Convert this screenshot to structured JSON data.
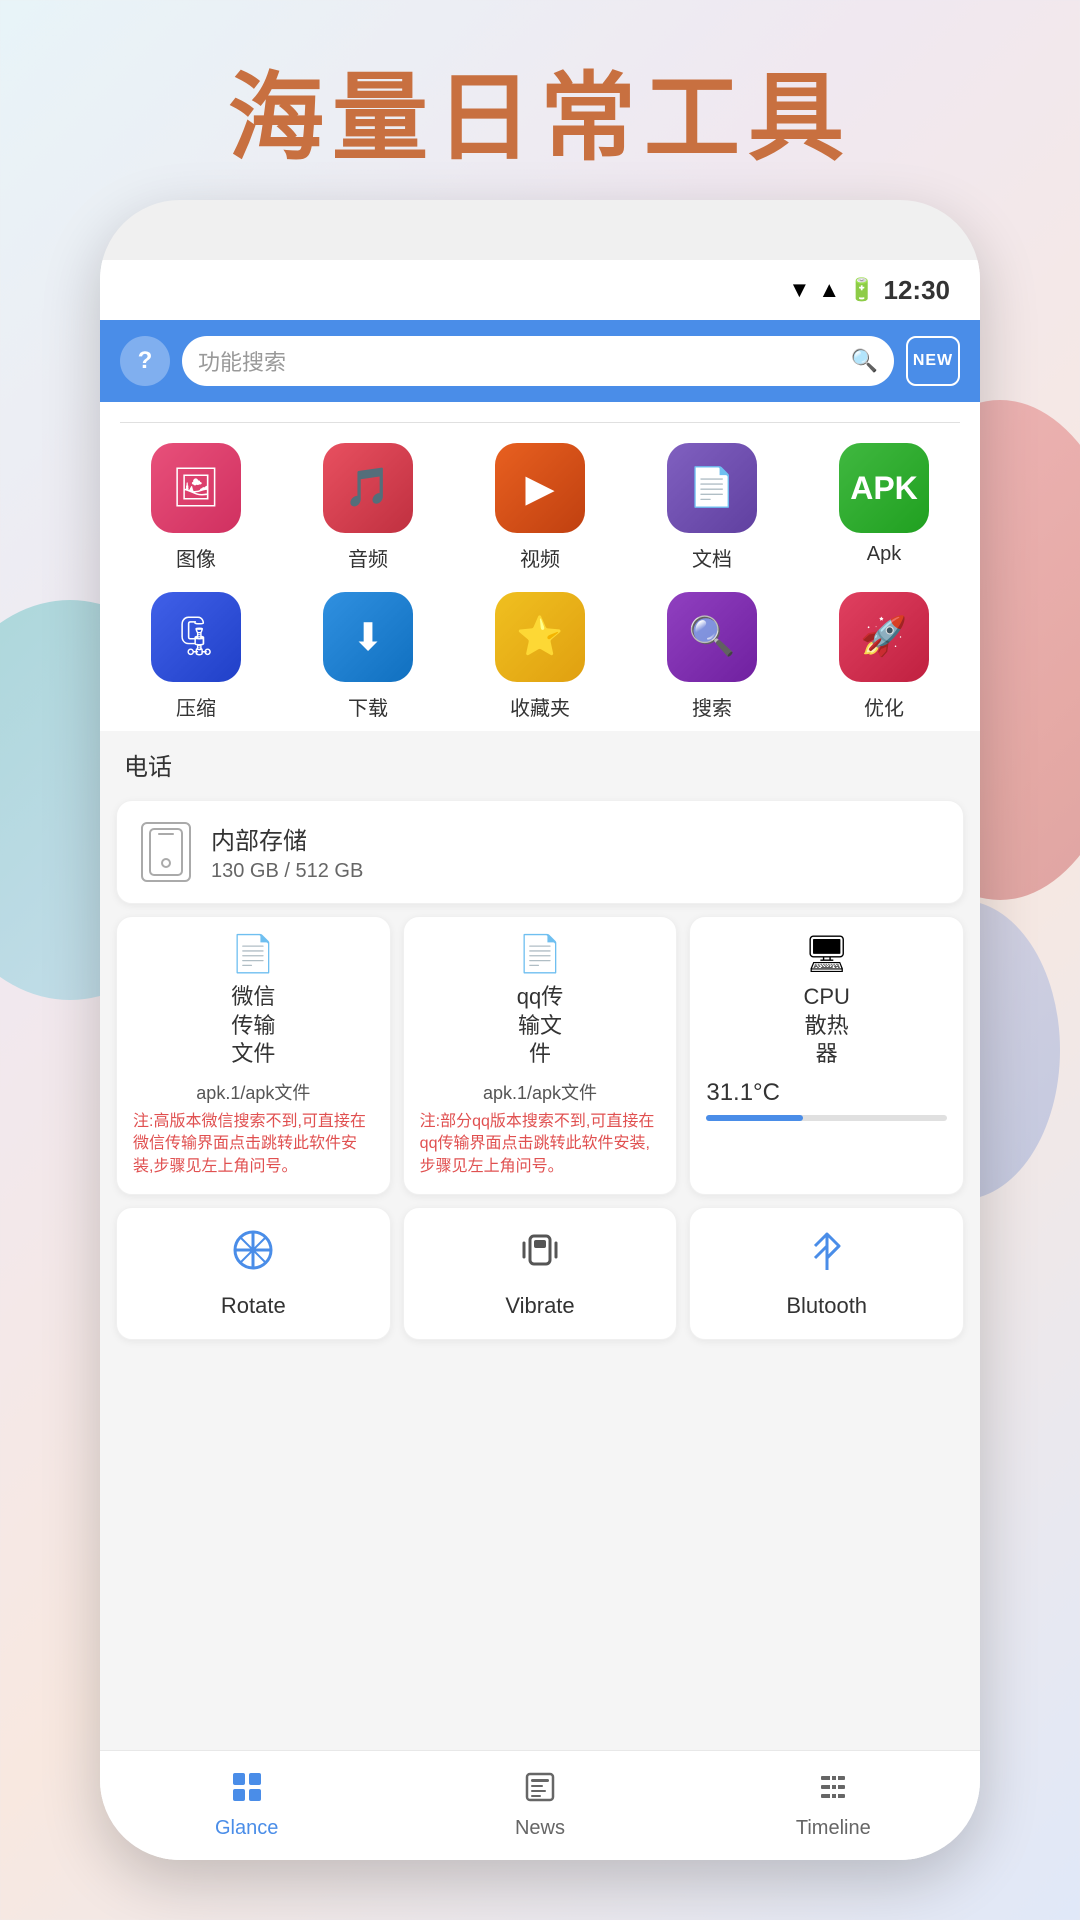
{
  "page": {
    "title": "海量日常工具",
    "title_color": "#c87040"
  },
  "status_bar": {
    "time": "12:30"
  },
  "header": {
    "search_placeholder": "功能搜索",
    "help_label": "?",
    "new_badge_text": "NEW"
  },
  "icon_rows": [
    [
      {
        "label": "图像",
        "color": "icon-pink",
        "emoji": "🖼"
      },
      {
        "label": "音频",
        "color": "icon-red",
        "emoji": "🎵"
      },
      {
        "label": "视频",
        "color": "icon-orange",
        "emoji": "▶"
      },
      {
        "label": "文档",
        "color": "icon-purple",
        "emoji": "📄"
      },
      {
        "label": "Apk",
        "color": "icon-green",
        "emoji": "📦"
      }
    ],
    [
      {
        "label": "压缩",
        "color": "icon-blue",
        "emoji": "🗜"
      },
      {
        "label": "下载",
        "color": "icon-blue2",
        "emoji": "⬇"
      },
      {
        "label": "收藏夹",
        "color": "icon-yellow",
        "emoji": "⭐"
      },
      {
        "label": "搜索",
        "color": "icon-purple2",
        "emoji": "🔍"
      },
      {
        "label": "优化",
        "color": "icon-red2",
        "emoji": "🚀"
      }
    ]
  ],
  "section_phone": {
    "label": "电话"
  },
  "storage": {
    "title": "内部存储",
    "detail": "130 GB / 512 GB"
  },
  "feature_cards": [
    {
      "title": "微信\n传输\n文件",
      "icon": "📄",
      "subtitle": "apk.1/apk文件",
      "desc": "注:高版本微信搜索不到,可直接在微信传输界面点击跳转此软件安装,步骤见左上角问号。"
    },
    {
      "title": "qq传\n输文\n件",
      "icon": "📄",
      "subtitle": "apk.1/apk文件",
      "desc": "注:部分qq版本搜索不到,可直接在qq传输界面点击跳转此软件安装,步骤见左上角问号。"
    },
    {
      "title": "CPU\n散热\n器",
      "icon": "🖥",
      "temp": "31.1°C",
      "bar_percent": 40
    }
  ],
  "tool_cards": [
    {
      "label": "Rotate",
      "emoji": "⊘"
    },
    {
      "label": "Vibrate",
      "emoji": "📳"
    },
    {
      "label": "Blutooth",
      "emoji": "✱"
    }
  ],
  "bottom_nav": {
    "items": [
      {
        "label": "Glance",
        "active": true
      },
      {
        "label": "News",
        "active": false
      },
      {
        "label": "Timeline",
        "active": false
      }
    ]
  }
}
